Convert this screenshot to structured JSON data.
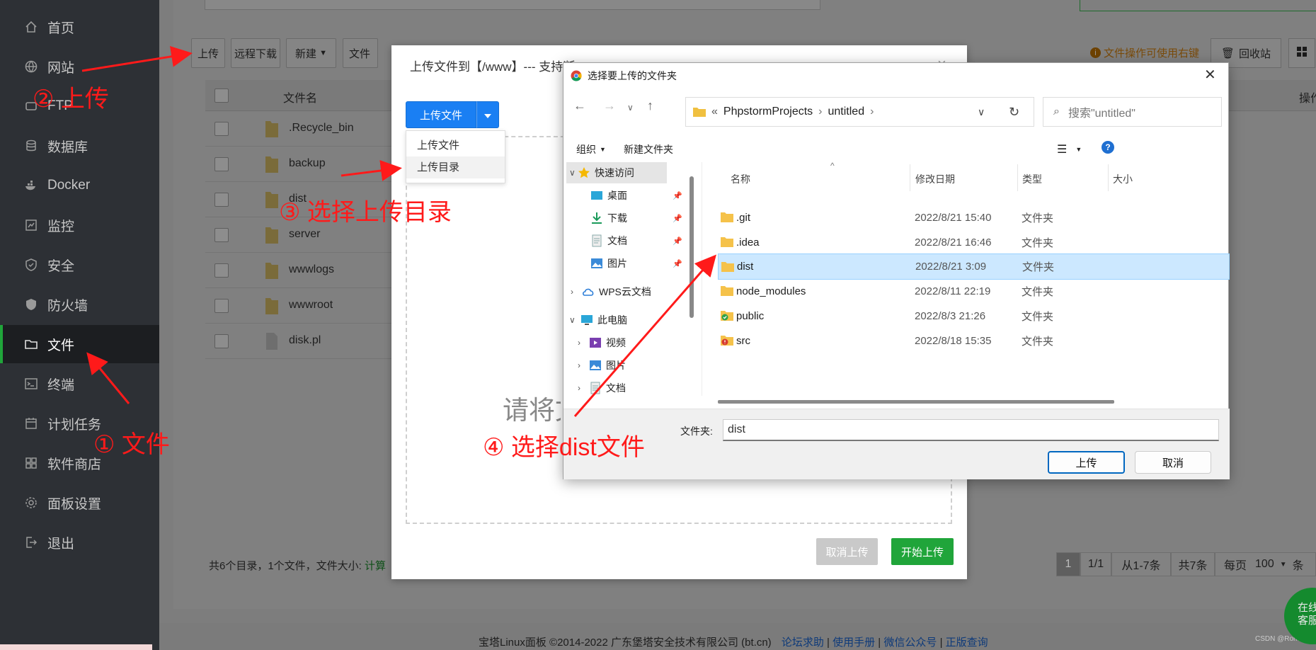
{
  "sidebar": {
    "items": [
      {
        "label": "首页",
        "icon": "home-icon"
      },
      {
        "label": "网站",
        "icon": "globe-icon"
      },
      {
        "label": "FTP",
        "icon": "ftp-icon"
      },
      {
        "label": "数据库",
        "icon": "database-icon"
      },
      {
        "label": "Docker",
        "icon": "docker-icon"
      },
      {
        "label": "监控",
        "icon": "monitor-icon"
      },
      {
        "label": "安全",
        "icon": "shield-icon"
      },
      {
        "label": "防火墙",
        "icon": "firewall-icon"
      },
      {
        "label": "文件",
        "icon": "folder-icon",
        "active": true
      },
      {
        "label": "终端",
        "icon": "terminal-icon"
      },
      {
        "label": "计划任务",
        "icon": "calendar-icon"
      },
      {
        "label": "软件商店",
        "icon": "apps-icon"
      },
      {
        "label": "面板设置",
        "icon": "gear-icon"
      },
      {
        "label": "退出",
        "icon": "logout-icon"
      }
    ]
  },
  "toolbar": {
    "upload": "上传",
    "remote_download": "远程下载",
    "new": "新建",
    "file_partial": "文件",
    "hint": "文件操作可使用右键",
    "recycle_bin": "回收站"
  },
  "table": {
    "col_name": "文件名",
    "col_op": "操作",
    "rows": [
      {
        "name": ".Recycle_bin",
        "type": "folder"
      },
      {
        "name": "backup",
        "type": "folder"
      },
      {
        "name": "dist",
        "type": "folder"
      },
      {
        "name": "server",
        "type": "folder"
      },
      {
        "name": "wwwlogs",
        "type": "folder"
      },
      {
        "name": "wwwroot",
        "type": "folder"
      },
      {
        "name": "disk.pl",
        "type": "file"
      }
    ]
  },
  "summary": {
    "text": "共6个目录，1个文件，文件大小:",
    "calc": "计算"
  },
  "pager": {
    "current": "1",
    "total": "1/1",
    "range": "从1-7条",
    "count": "共7条",
    "per_page_label": "每页",
    "per_page": "100",
    "tail": "条"
  },
  "footer": {
    "copyright": "宝塔Linux面板 ©2014-2022 广东堡塔安全技术有限公司 (bt.cn)",
    "links": [
      "论坛求助",
      "使用手册",
      "微信公众号",
      "正版查询"
    ],
    "watermark": "CSDN @Romki"
  },
  "service_bubble": {
    "line1": "在线",
    "line2": "客服"
  },
  "upload_dialog": {
    "title": "上传文件到【/www】--- 支持断点续传",
    "upload_button": "上传文件",
    "menu": [
      "上传文件",
      "上传目录"
    ],
    "drop_text": "请将文件拖拽到此处",
    "cancel": "取消上传",
    "start": "开始上传"
  },
  "picker": {
    "title": "选择要上传的文件夹",
    "address": {
      "prefix": "«",
      "parts": [
        "PhpstormProjects",
        "untitled"
      ]
    },
    "search_placeholder": "搜索\"untitled\"",
    "organize": "组织",
    "new_folder": "新建文件夹",
    "nav": [
      {
        "label": "快速访问",
        "icon": "star-icon",
        "level": 0,
        "selected": true,
        "expanded": true
      },
      {
        "label": "桌面",
        "icon": "desktop-icon",
        "level": 1,
        "pinned": true
      },
      {
        "label": "下载",
        "icon": "download-icon",
        "level": 1,
        "pinned": true
      },
      {
        "label": "文档",
        "icon": "document-icon",
        "level": 1,
        "pinned": true
      },
      {
        "label": "图片",
        "icon": "picture-icon",
        "level": 1,
        "pinned": true
      },
      {
        "label": "WPS云文档",
        "icon": "cloud-icon",
        "level": 0
      },
      {
        "label": "此电脑",
        "icon": "computer-icon",
        "level": 0,
        "expanded": true
      },
      {
        "label": "视频",
        "icon": "video-icon",
        "level": 1
      },
      {
        "label": "图片",
        "icon": "picture-icon",
        "level": 1
      },
      {
        "label": "文档",
        "icon": "document-icon",
        "level": 1
      }
    ],
    "columns": {
      "name": "名称",
      "date": "修改日期",
      "type": "类型",
      "size": "大小"
    },
    "files": [
      {
        "name": ".git",
        "date": "2022/8/21 15:40",
        "type": "文件夹"
      },
      {
        "name": ".idea",
        "date": "2022/8/21 16:46",
        "type": "文件夹"
      },
      {
        "name": "dist",
        "date": "2022/8/21 3:09",
        "type": "文件夹",
        "selected": true
      },
      {
        "name": "node_modules",
        "date": "2022/8/11 22:19",
        "type": "文件夹"
      },
      {
        "name": "public",
        "date": "2022/8/3 21:26",
        "type": "文件夹"
      },
      {
        "name": "src",
        "date": "2022/8/18 15:35",
        "type": "文件夹"
      }
    ],
    "folder_label": "文件夹:",
    "folder_value": "dist",
    "ok": "上传",
    "cancel": "取消"
  },
  "annotations": {
    "a1": "① 文件",
    "a2": "② 上传",
    "a3": "③ 选择上传目录",
    "a4": "④ 选择dist文件"
  },
  "colors": {
    "accent_green": "#20a53a",
    "blue": "#1a7ff3",
    "annotation_red": "#ff1a1a"
  }
}
